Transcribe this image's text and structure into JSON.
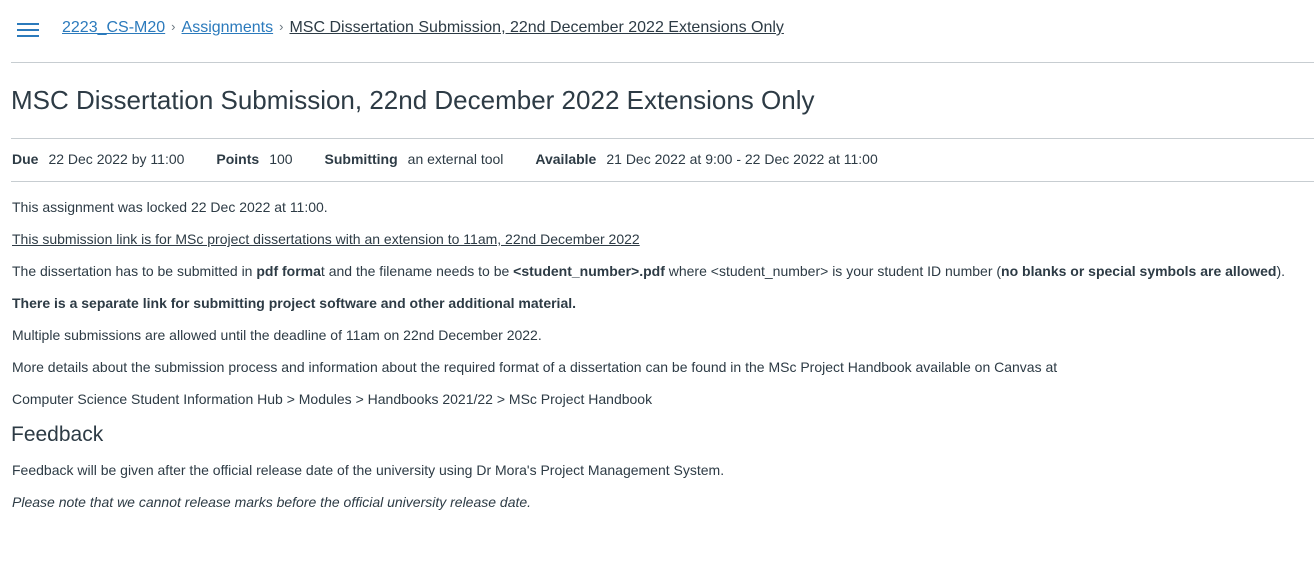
{
  "breadcrumb": {
    "course": "2223_CS-M20",
    "section": "Assignments",
    "current": "MSC Dissertation Submission, 22nd December 2022 Extensions Only",
    "separator": "›"
  },
  "title": "MSC Dissertation Submission, 22nd December 2022 Extensions Only",
  "details": {
    "due_label": "Due",
    "due_value": "22 Dec 2022 by 11:00",
    "points_label": "Points",
    "points_value": "100",
    "submitting_label": "Submitting",
    "submitting_value": "an external tool",
    "available_label": "Available",
    "available_value": "21 Dec 2022 at 9:00 - 22 Dec 2022 at 11:00"
  },
  "body": {
    "locked": "This assignment was locked 22 Dec 2022 at 11:00.",
    "link_note": "This submission link is for MSc project dissertations with an extension to 11am, 22nd December 2022",
    "format": {
      "p1": "The dissertation has to be submitted in ",
      "b1": "pdf forma",
      "p2": "t and the filename needs to be ",
      "b2": "<student_number>.pdf",
      "p3": " where <student_number>  is your student ID number (",
      "b3": "no blanks or special symbols are allowed",
      "p4": ")."
    },
    "separate_link": "There is a separate link for submitting project software and other additional material.",
    "multiple": "Multiple submissions are allowed until the deadline of 11am on 22nd December 2022.",
    "details_text": "More details about the submission process and information about the required format of a dissertation can be found in the MSc Project Handbook available on Canvas at",
    "path": "Computer Science Student Information Hub > Modules > Handbooks 2021/22 > MSc Project Handbook",
    "feedback_heading": "Feedback",
    "feedback_text": "Feedback will be given after the official release date of the university using Dr Mora's Project Management System.",
    "note": "Please note that we cannot release marks before the official university release date."
  },
  "colors": {
    "link": "#2b7abc",
    "text": "#2d3b45",
    "rule": "#c7cdd1",
    "hamburger": "#2b7abc"
  },
  "icons": {
    "menu": "hamburger-menu-icon",
    "breadcrumb_separator": "chevron-right-icon"
  }
}
